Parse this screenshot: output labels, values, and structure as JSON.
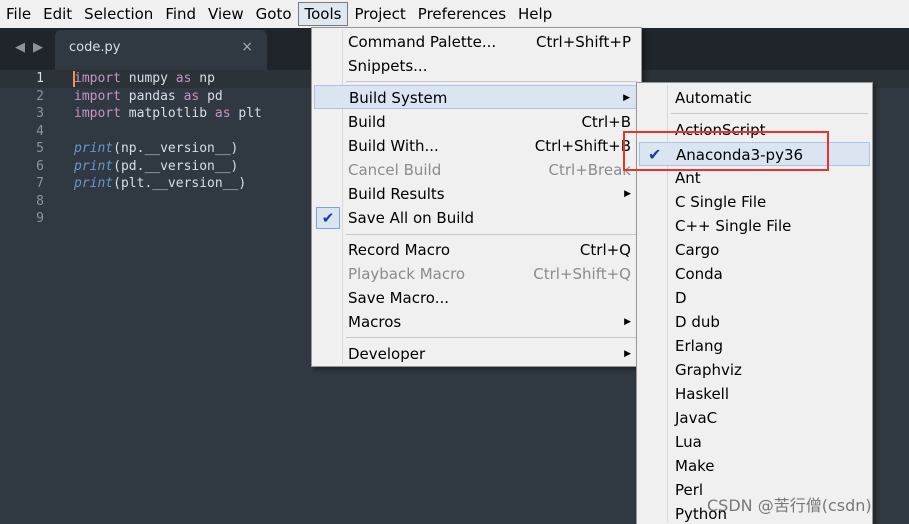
{
  "menubar": {
    "items": [
      "File",
      "Edit",
      "Selection",
      "Find",
      "View",
      "Goto",
      "Tools",
      "Project",
      "Preferences",
      "Help"
    ]
  },
  "tab": {
    "title": "code.py",
    "close": "×"
  },
  "editor": {
    "line_numbers": [
      "1",
      "2",
      "3",
      "4",
      "5",
      "6",
      "7",
      "8",
      "9"
    ]
  },
  "tools_menu": {
    "command_palette": "Command Palette...",
    "command_palette_sc": "Ctrl+Shift+P",
    "snippets": "Snippets...",
    "build_system": "Build System",
    "build": "Build",
    "build_sc": "Ctrl+B",
    "build_with": "Build With...",
    "build_with_sc": "Ctrl+Shift+B",
    "cancel_build": "Cancel Build",
    "cancel_build_sc": "Ctrl+Break",
    "build_results": "Build Results",
    "save_all_on_build": "Save All on Build",
    "record_macro": "Record Macro",
    "record_macro_sc": "Ctrl+Q",
    "playback_macro": "Playback Macro",
    "playback_macro_sc": "Ctrl+Shift+Q",
    "save_macro": "Save Macro...",
    "macros": "Macros",
    "developer": "Developer"
  },
  "build_system_menu": {
    "items": [
      "Automatic",
      "ActionScript",
      "Anaconda3-py36",
      "Ant",
      "C Single File",
      "C++ Single File",
      "Cargo",
      "Conda",
      "D",
      "D dub",
      "Erlang",
      "Graphviz",
      "Haskell",
      "JavaC",
      "Lua",
      "Make",
      "Perl",
      "Python"
    ],
    "selected": "Anaconda3-py36"
  },
  "watermark": "CSDN @苦行僧(csdn)",
  "colors": {
    "accent_check": "#1a3da0",
    "highlight_box": "#e8342c"
  }
}
